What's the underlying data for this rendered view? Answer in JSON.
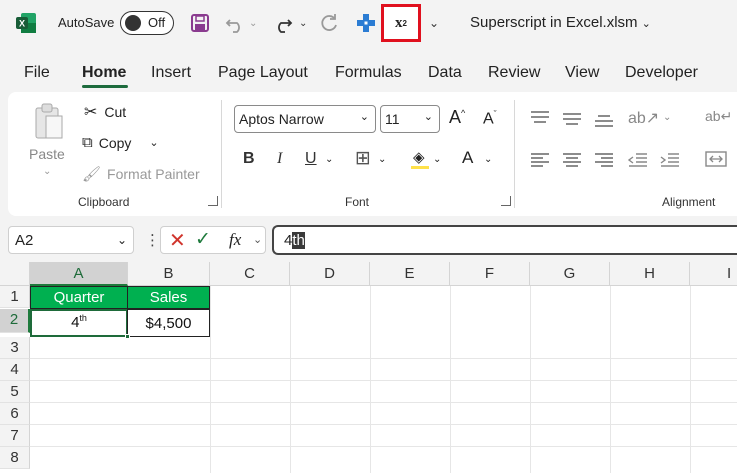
{
  "titlebar": {
    "autosave_label": "AutoSave",
    "autosave_state": "Off",
    "file_name": "Superscript in Excel.xlsm",
    "superscript_btn": {
      "base": "x",
      "exp": "2"
    }
  },
  "tabs": [
    "File",
    "Home",
    "Insert",
    "Page Layout",
    "Formulas",
    "Data",
    "Review",
    "View",
    "Developer"
  ],
  "ribbon": {
    "clipboard": {
      "paste": "Paste",
      "cut": "Cut",
      "copy": "Copy",
      "format_painter": "Format Painter",
      "label": "Clipboard"
    },
    "font": {
      "font_name": "Aptos Narrow",
      "font_size": "11",
      "bold": "B",
      "italic": "I",
      "underline": "U",
      "label": "Font"
    },
    "alignment": {
      "label": "Alignment"
    }
  },
  "formula_bar": {
    "name_box": "A2",
    "fx": "fx",
    "content_plain": "4",
    "content_selected": "th"
  },
  "grid": {
    "columns": [
      "A",
      "B",
      "C",
      "D",
      "E",
      "F",
      "G",
      "H",
      "I"
    ],
    "rows": [
      "1",
      "2",
      "3",
      "4",
      "5",
      "6",
      "7",
      "8"
    ],
    "cells": {
      "a1": "Quarter",
      "b1": "Sales",
      "a2_base": "4",
      "a2_sup": "th",
      "b2": "$4,500"
    }
  },
  "colors": {
    "excel_green": "#1e6b3a",
    "header_fill": "#00b050",
    "highlight_red": "#e0101e"
  }
}
